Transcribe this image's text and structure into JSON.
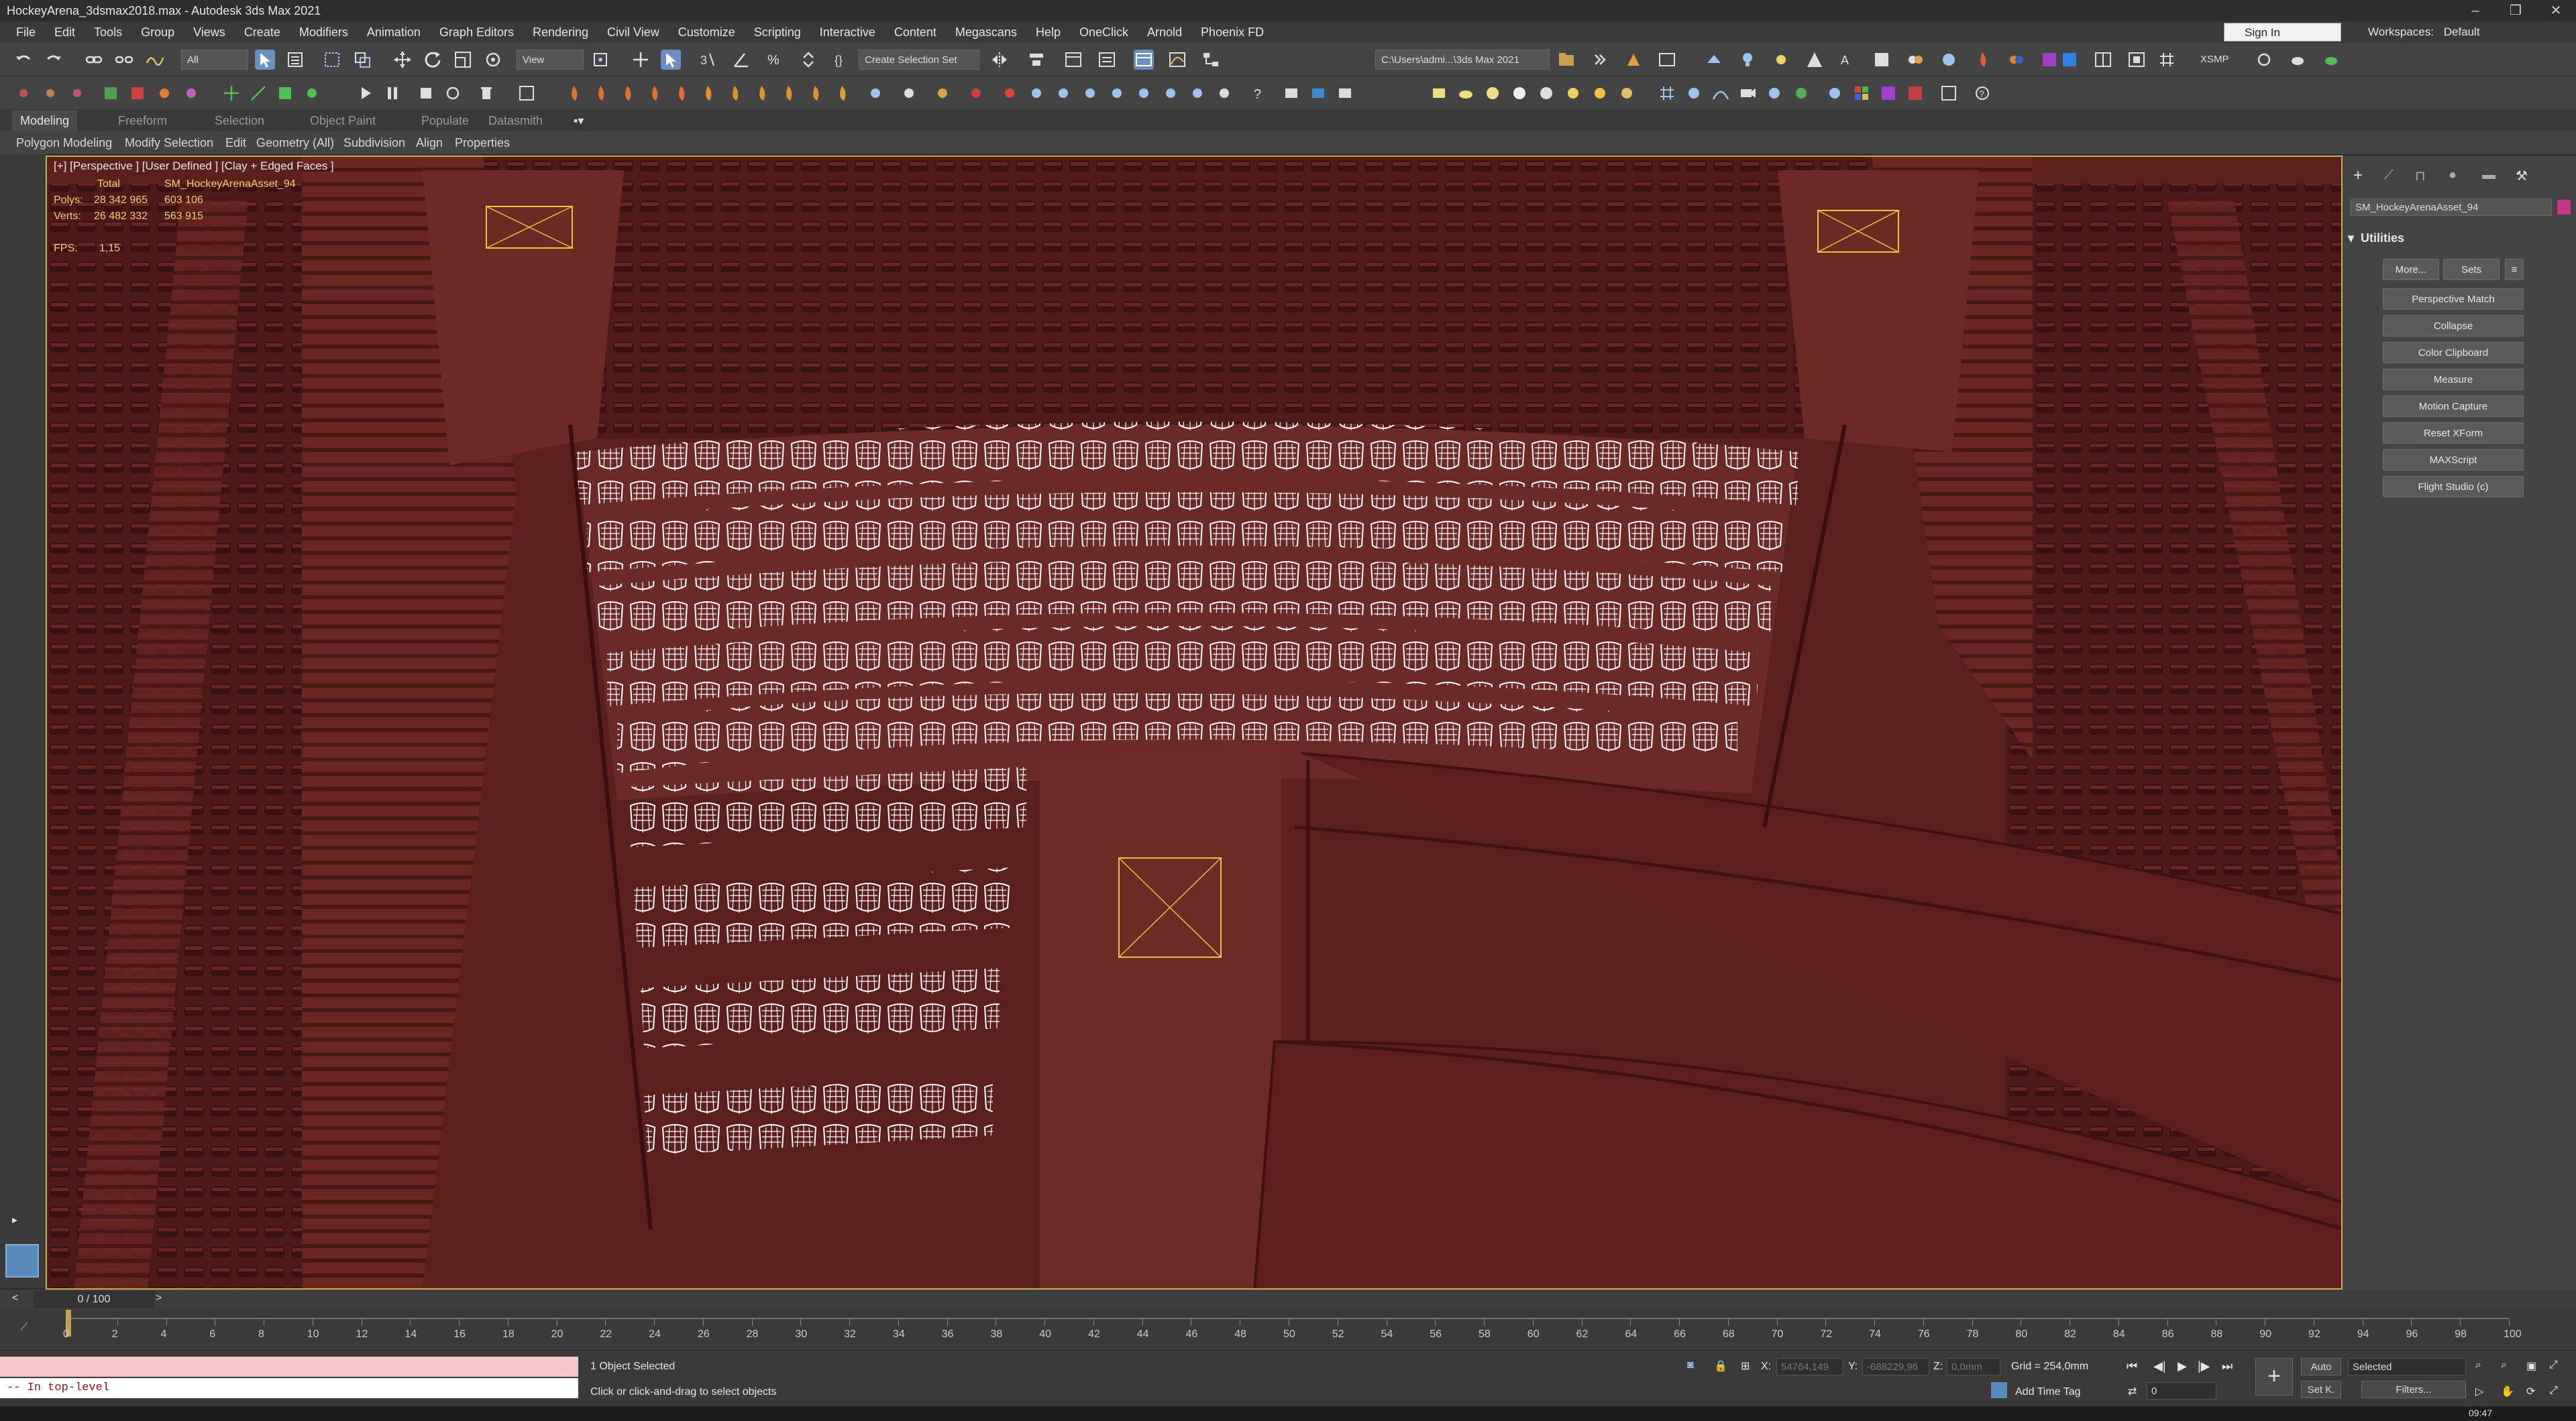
{
  "window": {
    "title": "HockeyArena_3dsmax2018.max - Autodesk 3ds Max 2021",
    "controls": [
      "–",
      "❐",
      "✕"
    ]
  },
  "menu": [
    "File",
    "Edit",
    "Tools",
    "Group",
    "Views",
    "Create",
    "Modifiers",
    "Animation",
    "Graph Editors",
    "Rendering",
    "Civil View",
    "Customize",
    "Scripting",
    "Interactive",
    "Content",
    "Megascans",
    "Help",
    "OneClick",
    "Arnold",
    "Phoenix FD"
  ],
  "account": {
    "signin": "Sign In",
    "workspaces_label": "Workspaces:",
    "workspace": "Default"
  },
  "toolbar": {
    "filter": "All",
    "coord_system": "View",
    "selection_set": "Create Selection Set",
    "project_path": "C:\\Users\\admi...\\3ds Max 2021",
    "xsmp": "XSMP"
  },
  "ribbon": {
    "tabs": [
      "Modeling",
      "Freeform",
      "Selection",
      "Object Paint",
      "Populate",
      "Datasmith"
    ],
    "active_tab": "Modeling",
    "subtabs": [
      "Polygon Modeling",
      "Modify Selection",
      "Edit",
      "Geometry (All)",
      "Subdivision",
      "Align",
      "Properties"
    ]
  },
  "viewport": {
    "label": "[+] [Perspective ] [User Defined ] [Clay + Edged Faces ]",
    "stats": {
      "col_total": "Total",
      "col_object": "SM_HockeyArenaAsset_94",
      "polys_label": "Polys:",
      "polys_total": "28 342 965",
      "polys_obj": "603 106",
      "verts_label": "Verts:",
      "verts_total": "26 482 332",
      "verts_obj": "563 915",
      "fps_label": "FPS:",
      "fps": "1,15"
    },
    "colors": {
      "bg": "#5a1f1c",
      "wire": "#ffffff",
      "camera": "#f0c040"
    }
  },
  "command_panel": {
    "object_name": "SM_HockeyArenaAsset_94",
    "rollout": "Utilities",
    "top_buttons": [
      "More...",
      "Sets"
    ],
    "utilities": [
      "Perspective Match",
      "Collapse",
      "Color Clipboard",
      "Measure",
      "Motion Capture",
      "Reset XForm",
      "MAXScript",
      "Flight Studio (c)"
    ]
  },
  "timeline": {
    "frame": "0 / 100",
    "ticks": [
      "0",
      "2",
      "4",
      "6",
      "8",
      "10",
      "12",
      "14",
      "16",
      "18",
      "20",
      "22",
      "24",
      "26",
      "28",
      "30",
      "32",
      "34",
      "36",
      "38",
      "40",
      "42",
      "44",
      "46",
      "48",
      "50",
      "52",
      "54",
      "56",
      "58",
      "60",
      "62",
      "64",
      "66",
      "68",
      "70",
      "72",
      "74",
      "76",
      "78",
      "80",
      "82",
      "84",
      "86",
      "88",
      "90",
      "92",
      "94",
      "96",
      "98",
      "100"
    ]
  },
  "status": {
    "maxscript": "-- In top-level",
    "selected": "1 Object Selected",
    "prompt": "Click or click-and-drag to select objects",
    "x_label": "X:",
    "x_value": "54764,149",
    "y_label": "Y:",
    "y_value": "-688229,96",
    "z_label": "Z:",
    "z_value": "0,0mm",
    "grid": "Grid = 254,0mm",
    "add_time_tag": "Add Time Tag",
    "auto": "Auto",
    "set_key": "Set K.",
    "key_mode": "Selected",
    "filters": "Filters...",
    "frame_field": "0",
    "clock": "09:47"
  }
}
